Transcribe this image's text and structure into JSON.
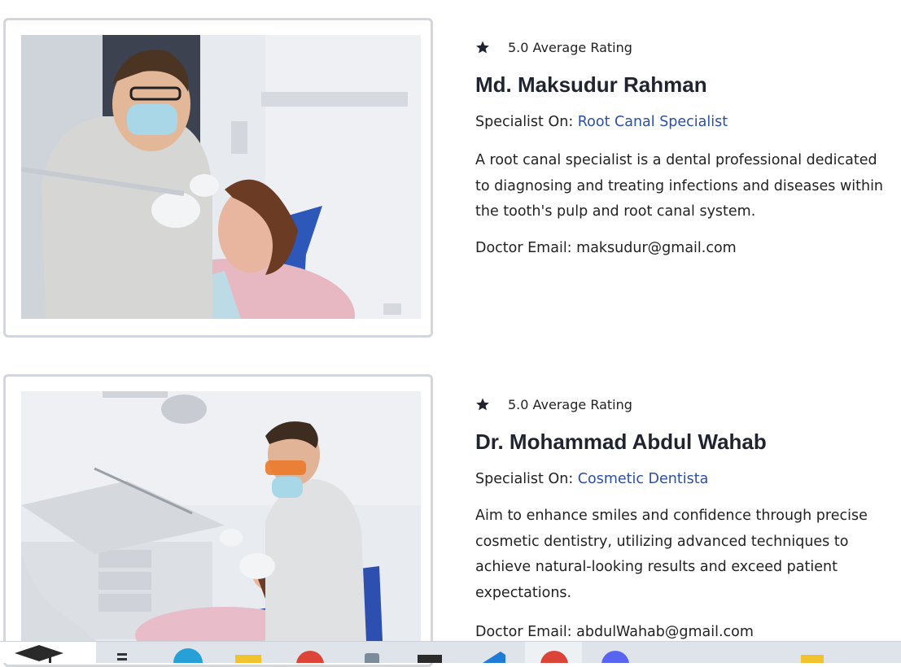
{
  "doctors": [
    {
      "rating": "5.0 Average Rating",
      "name": "Md. Maksudur Rahman",
      "specialist_label": "Specialist On:",
      "specialty": "Root Canal Specialist",
      "description_lines": [
        "A root canal specialist is a dental professional dedicated",
        "to diagnosing and treating infections and diseases within",
        "the tooth's pulp and root canal system."
      ],
      "email_label": "Doctor Email:",
      "email": "maksudur@gmail.com"
    },
    {
      "rating": "5.0 Average Rating",
      "name": "Dr. Mohammad Abdul Wahab",
      "specialist_label": "Specialist On:",
      "specialty": "Cosmetic Dentista",
      "description_lines": [
        "Aim to enhance smiles and confidence through precise",
        "cosmetic dentistry, utilizing advanced techniques to",
        "achieve natural-looking results and exceed patient",
        "expectations."
      ],
      "email_label": "Doctor Email:",
      "email": "abdulWahab@gmail.com"
    }
  ],
  "colors": {
    "link": "#2b4fa8",
    "heading": "#1f2430",
    "frame": "#d4d6dc",
    "taskbar": "#dfe4ea"
  },
  "taskbar": {
    "icons": [
      "graduation-cap-icon",
      "file-explorer-icon",
      "edge-icon",
      "folder-icon",
      "chrome-icon",
      "phone-link-icon",
      "terminal-icon",
      "vscode-icon",
      "chrome-icon",
      "discord-icon",
      "sticky-notes-icon"
    ]
  }
}
